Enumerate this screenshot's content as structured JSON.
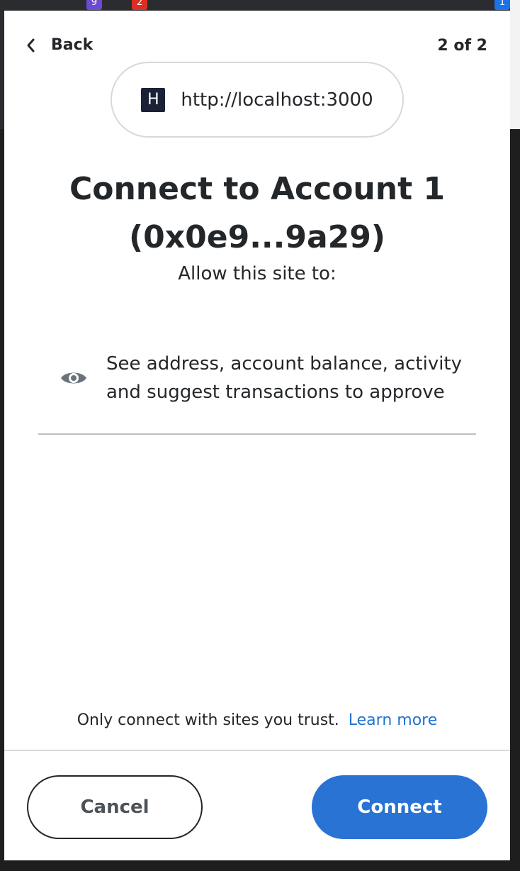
{
  "header": {
    "back_label": "Back",
    "page_counter": "2 of 2"
  },
  "site": {
    "favicon_letter": "H",
    "url": "http://localhost:3000"
  },
  "title_line1": "Connect to Account 1",
  "title_line2": "(0x0e9...9a29)",
  "subtitle": "Allow this site to:",
  "permission": {
    "icon": "eye-icon",
    "line1": "See address, account balance, activity",
    "line2": "and suggest transactions to approve"
  },
  "footer": {
    "trust_text": "Only connect with sites you trust.",
    "learn_more": "Learn more",
    "cancel_label": "Cancel",
    "connect_label": "Connect"
  },
  "chrome_badges": {
    "badge_a": "9",
    "badge_b": "2",
    "badge_c": "1"
  },
  "colors": {
    "primary": "#2873d4",
    "link": "#1f74d1",
    "text": "#24272a"
  }
}
